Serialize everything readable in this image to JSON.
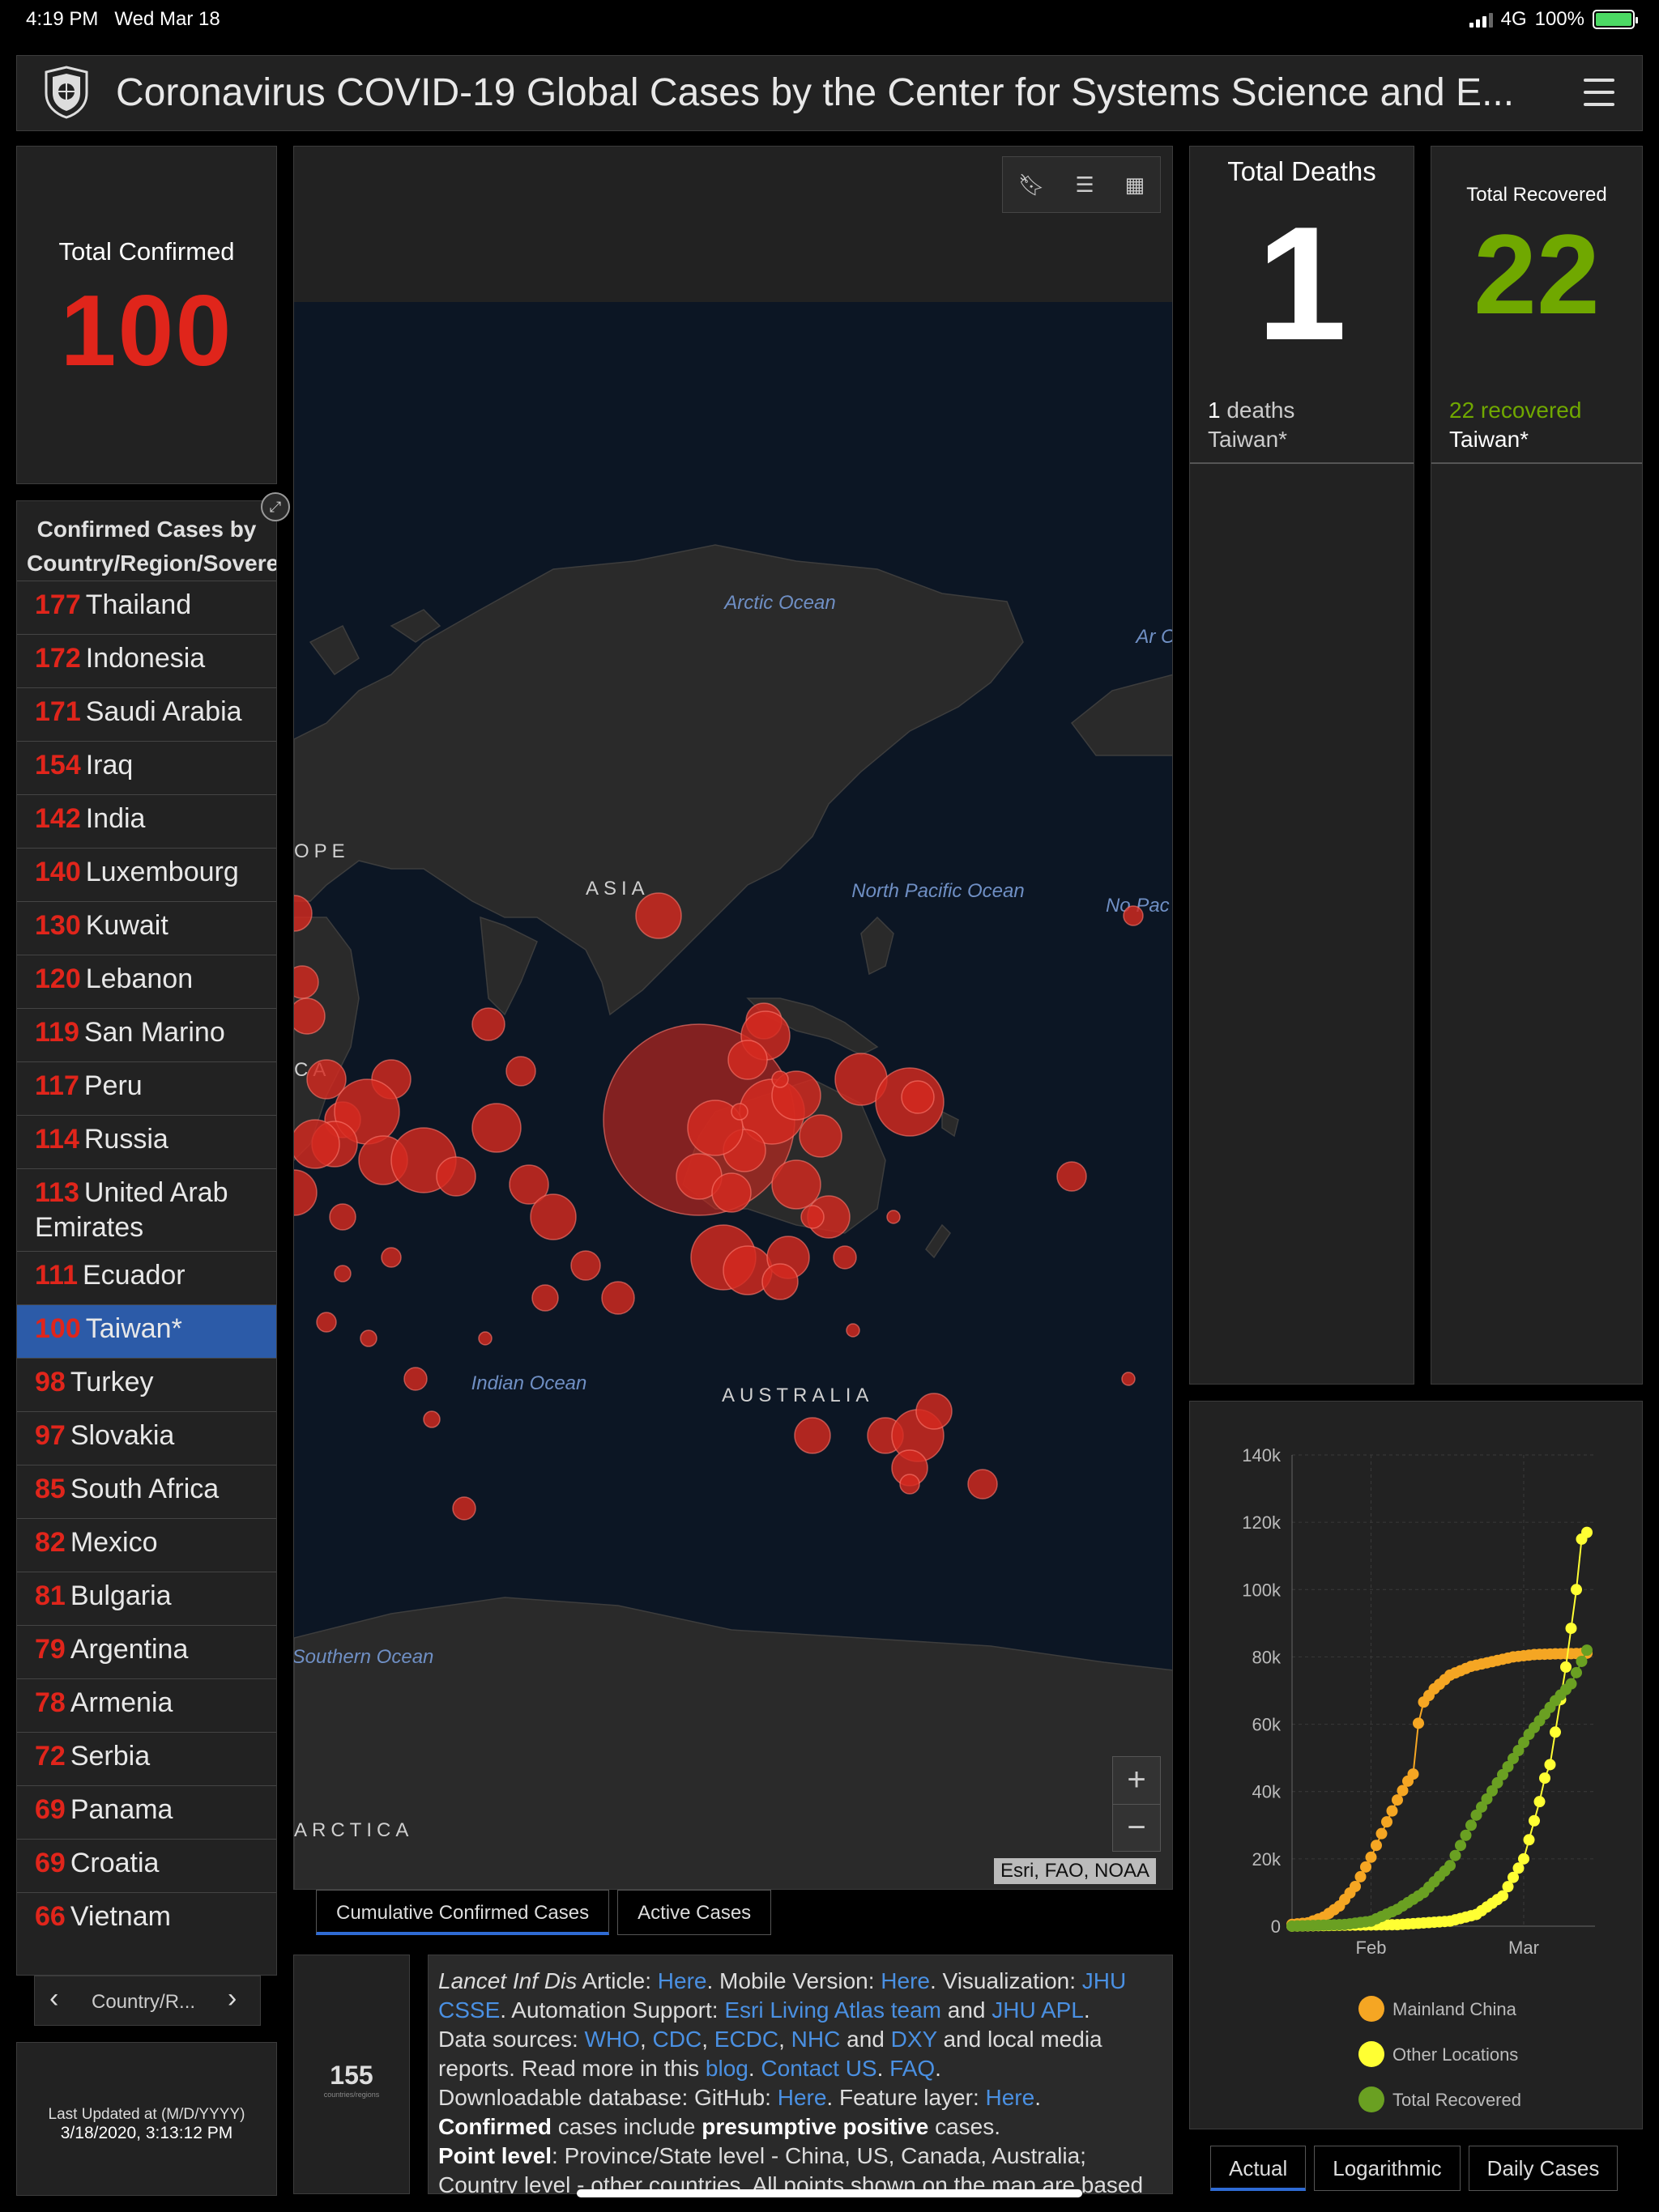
{
  "status_bar": {
    "time": "4:19 PM",
    "date": "Wed Mar 18",
    "network": "4G",
    "battery": "100%"
  },
  "header": {
    "title": "Coronavirus COVID-19 Global Cases by the Center for Systems Science and E..."
  },
  "total_confirmed": {
    "label": "Total Confirmed",
    "value": "100"
  },
  "country_list": {
    "title": "Confirmed Cases by Country/Region/Sovereignty",
    "rows": [
      {
        "num": "177",
        "name": "Thailand"
      },
      {
        "num": "172",
        "name": "Indonesia"
      },
      {
        "num": "171",
        "name": "Saudi Arabia"
      },
      {
        "num": "154",
        "name": "Iraq"
      },
      {
        "num": "142",
        "name": "India"
      },
      {
        "num": "140",
        "name": "Luxembourg"
      },
      {
        "num": "130",
        "name": "Kuwait"
      },
      {
        "num": "120",
        "name": "Lebanon"
      },
      {
        "num": "119",
        "name": "San Marino"
      },
      {
        "num": "117",
        "name": "Peru"
      },
      {
        "num": "114",
        "name": "Russia"
      },
      {
        "num": "113",
        "name": "United Arab Emirates"
      },
      {
        "num": "111",
        "name": "Ecuador"
      },
      {
        "num": "100",
        "name": "Taiwan*",
        "active": true
      },
      {
        "num": "98",
        "name": "Turkey"
      },
      {
        "num": "97",
        "name": "Slovakia"
      },
      {
        "num": "85",
        "name": "South Africa"
      },
      {
        "num": "82",
        "name": "Mexico"
      },
      {
        "num": "81",
        "name": "Bulgaria"
      },
      {
        "num": "79",
        "name": "Argentina"
      },
      {
        "num": "78",
        "name": "Armenia"
      },
      {
        "num": "72",
        "name": "Serbia"
      },
      {
        "num": "69",
        "name": "Panama"
      },
      {
        "num": "69",
        "name": "Croatia"
      },
      {
        "num": "66",
        "name": "Vietnam"
      }
    ],
    "pager_label": "Country/R..."
  },
  "last_updated": {
    "label": "Last Updated at (M/D/YYYY)",
    "value": "3/18/2020, 3:13:12 PM"
  },
  "map": {
    "labels": {
      "arctic": "Arctic Ocean",
      "asia": "ASIA",
      "europe": "OPE",
      "africa": "CA",
      "north_pacific": "North Pacific Ocean",
      "north_pacific_cut": "No Pac Oc",
      "arctic_cut": "Ar Oc",
      "indian": "Indian Ocean",
      "australia": "AUSTRALIA",
      "southern": "Southern Ocean",
      "antarctica": "ARCTICA"
    },
    "attribution": "Esri, FAO, NOAA",
    "tabs": [
      "Cumulative Confirmed Cases",
      "Active Cases"
    ]
  },
  "count_box": {
    "value": "155",
    "label": "countries/regions"
  },
  "info": {
    "p1_a": "Lancet Inf Dis",
    "p1_b": " Article: ",
    "here1": "Here",
    "p1_c": ". Mobile Version: ",
    "here2": "Here",
    "p1_d": ". Visualization: ",
    "jhu": "JHU CSSE",
    "p1_e": ". Automation Support: ",
    "esri": "Esri Living Atlas team",
    "and1": " and ",
    "apl": "JHU APL",
    "p1_f": ".",
    "ds": "Data sources: ",
    "who": "WHO",
    "cdc": "CDC",
    "ecdc": "ECDC",
    "nhc": "NHC",
    "dxy": "DXY",
    "ds_tail": " and local media reports. Read more in this ",
    "blog": "blog",
    "contact": "Contact US",
    "faq": "FAQ",
    "dl": "Downloadable database: GitHub: ",
    "here3": "Here",
    "fl": ". Feature layer: ",
    "here4": "Here",
    "confirmed_bold": "Confirmed",
    "confirmed_mid": " cases include ",
    "presumptive": "presumptive positive",
    "confirmed_end": " cases.",
    "point_bold": "Point level",
    "point_text": ": Province/State level - China, US, Canada, Australia; Country level - other countries. All points shown on the map are based"
  },
  "total_deaths": {
    "label": "Total Deaths",
    "value": "1",
    "sub_num": "1",
    "sub_word": " deaths",
    "sub_place": "Taiwan*"
  },
  "total_recovered": {
    "label": "Total Recovered",
    "value": "22",
    "sub_num": "22",
    "sub_word": " recovered",
    "sub_place": "Taiwan*"
  },
  "chart_data": {
    "type": "line",
    "x_ticks": [
      "Feb",
      "Mar"
    ],
    "y_ticks": [
      "0",
      "20k",
      "40k",
      "60k",
      "80k",
      "100k",
      "120k",
      "140k"
    ],
    "ylim": [
      0,
      140000
    ],
    "x_range_days": [
      0,
      56
    ],
    "series": [
      {
        "name": "Mainland China",
        "color": "#f5a623",
        "points": [
          [
            0,
            548
          ],
          [
            3,
            1000
          ],
          [
            6,
            2700
          ],
          [
            9,
            6000
          ],
          [
            12,
            11800
          ],
          [
            15,
            20500
          ],
          [
            18,
            31000
          ],
          [
            20,
            37500
          ],
          [
            22,
            43100
          ],
          [
            23,
            45200
          ],
          [
            24,
            60300
          ],
          [
            25,
            66600
          ],
          [
            27,
            70500
          ],
          [
            30,
            74600
          ],
          [
            34,
            77200
          ],
          [
            38,
            78600
          ],
          [
            42,
            80000
          ],
          [
            46,
            80700
          ],
          [
            50,
            80900
          ],
          [
            54,
            81000
          ],
          [
            56,
            81100
          ]
        ]
      },
      {
        "name": "Other Locations",
        "color": "#ffff33",
        "points": [
          [
            0,
            7
          ],
          [
            10,
            300
          ],
          [
            20,
            450
          ],
          [
            30,
            1500
          ],
          [
            35,
            3500
          ],
          [
            40,
            9000
          ],
          [
            44,
            20000
          ],
          [
            47,
            37000
          ],
          [
            48,
            44000
          ],
          [
            49,
            48000
          ],
          [
            52,
            77000
          ],
          [
            54,
            100000
          ],
          [
            55,
            115000
          ],
          [
            56,
            117000
          ]
        ]
      },
      {
        "name": "Total Recovered",
        "color": "#6aa022",
        "points": [
          [
            0,
            28
          ],
          [
            10,
            500
          ],
          [
            15,
            1500
          ],
          [
            20,
            5000
          ],
          [
            25,
            10000
          ],
          [
            30,
            18000
          ],
          [
            35,
            33000
          ],
          [
            40,
            45000
          ],
          [
            45,
            57000
          ],
          [
            50,
            67000
          ],
          [
            53,
            72000
          ],
          [
            56,
            82000
          ]
        ]
      }
    ],
    "legend": [
      "Mainland China",
      "Other Locations",
      "Total Recovered"
    ],
    "tabs": [
      "Actual",
      "Logarithmic",
      "Daily Cases"
    ]
  }
}
